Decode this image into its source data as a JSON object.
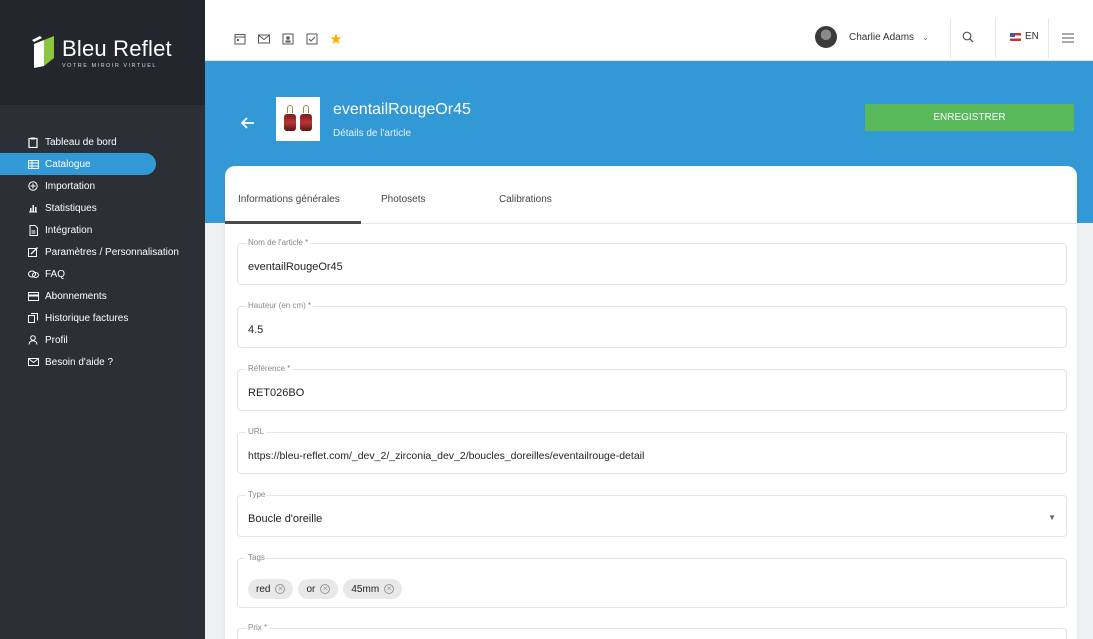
{
  "brand": {
    "title": "Bleu Reflet",
    "tagline": "VOTRE MIROIR VIRTUEL"
  },
  "sidebar": {
    "items": [
      {
        "label": "Tableau de bord",
        "icon": "clipboard-icon",
        "active": false
      },
      {
        "label": "Catalogue",
        "icon": "table-icon",
        "active": true
      },
      {
        "label": "Importation",
        "icon": "plus-circle-icon",
        "active": false
      },
      {
        "label": "Statistiques",
        "icon": "chart-icon",
        "active": false
      },
      {
        "label": "Intégration",
        "icon": "file-icon",
        "active": false
      },
      {
        "label": "Paramètres / Personnalisation",
        "icon": "edit-icon",
        "active": false
      },
      {
        "label": "FAQ",
        "icon": "chat-icon",
        "active": false
      },
      {
        "label": "Abonnements",
        "icon": "card-icon",
        "active": false
      },
      {
        "label": "Historique factures",
        "icon": "copy-icon",
        "active": false
      },
      {
        "label": "Profil",
        "icon": "user-icon",
        "active": false
      },
      {
        "label": "Besoin d'aide ?",
        "icon": "mail-icon",
        "active": false
      }
    ]
  },
  "topbar": {
    "icons": [
      "calendar-icon",
      "mail-icon",
      "user-card-icon",
      "checkbox-icon",
      "star-icon"
    ],
    "user_name": "Charlie Adams",
    "language": "EN"
  },
  "header": {
    "article_name": "eventailRougeOr45",
    "subtitle": "Détails de l'article",
    "save_label": "ENREGISTRER"
  },
  "tabs": [
    "Informations générales",
    "Photosets",
    "Calibrations"
  ],
  "form": {
    "name": {
      "label": "Nom de l'article *",
      "value": "eventailRougeOr45"
    },
    "height": {
      "label": "Hauteur (en cm) *",
      "value": "4.5"
    },
    "reference": {
      "label": "Référence *",
      "value": "RET026BO"
    },
    "url": {
      "label": "URL",
      "value": "https://bleu-reflet.com/_dev_2/_zirconia_dev_2/boucles_doreilles/eventailrouge-detail"
    },
    "type": {
      "label": "Type",
      "value": "Boucle d'oreille"
    },
    "tags": {
      "label": "Tags",
      "items": [
        "red",
        "or",
        "45mm"
      ]
    },
    "price": {
      "label": "Prix *"
    }
  },
  "colors": {
    "accent": "#3399d6",
    "save": "#59b85a",
    "sidebar": "#2b2f36"
  }
}
